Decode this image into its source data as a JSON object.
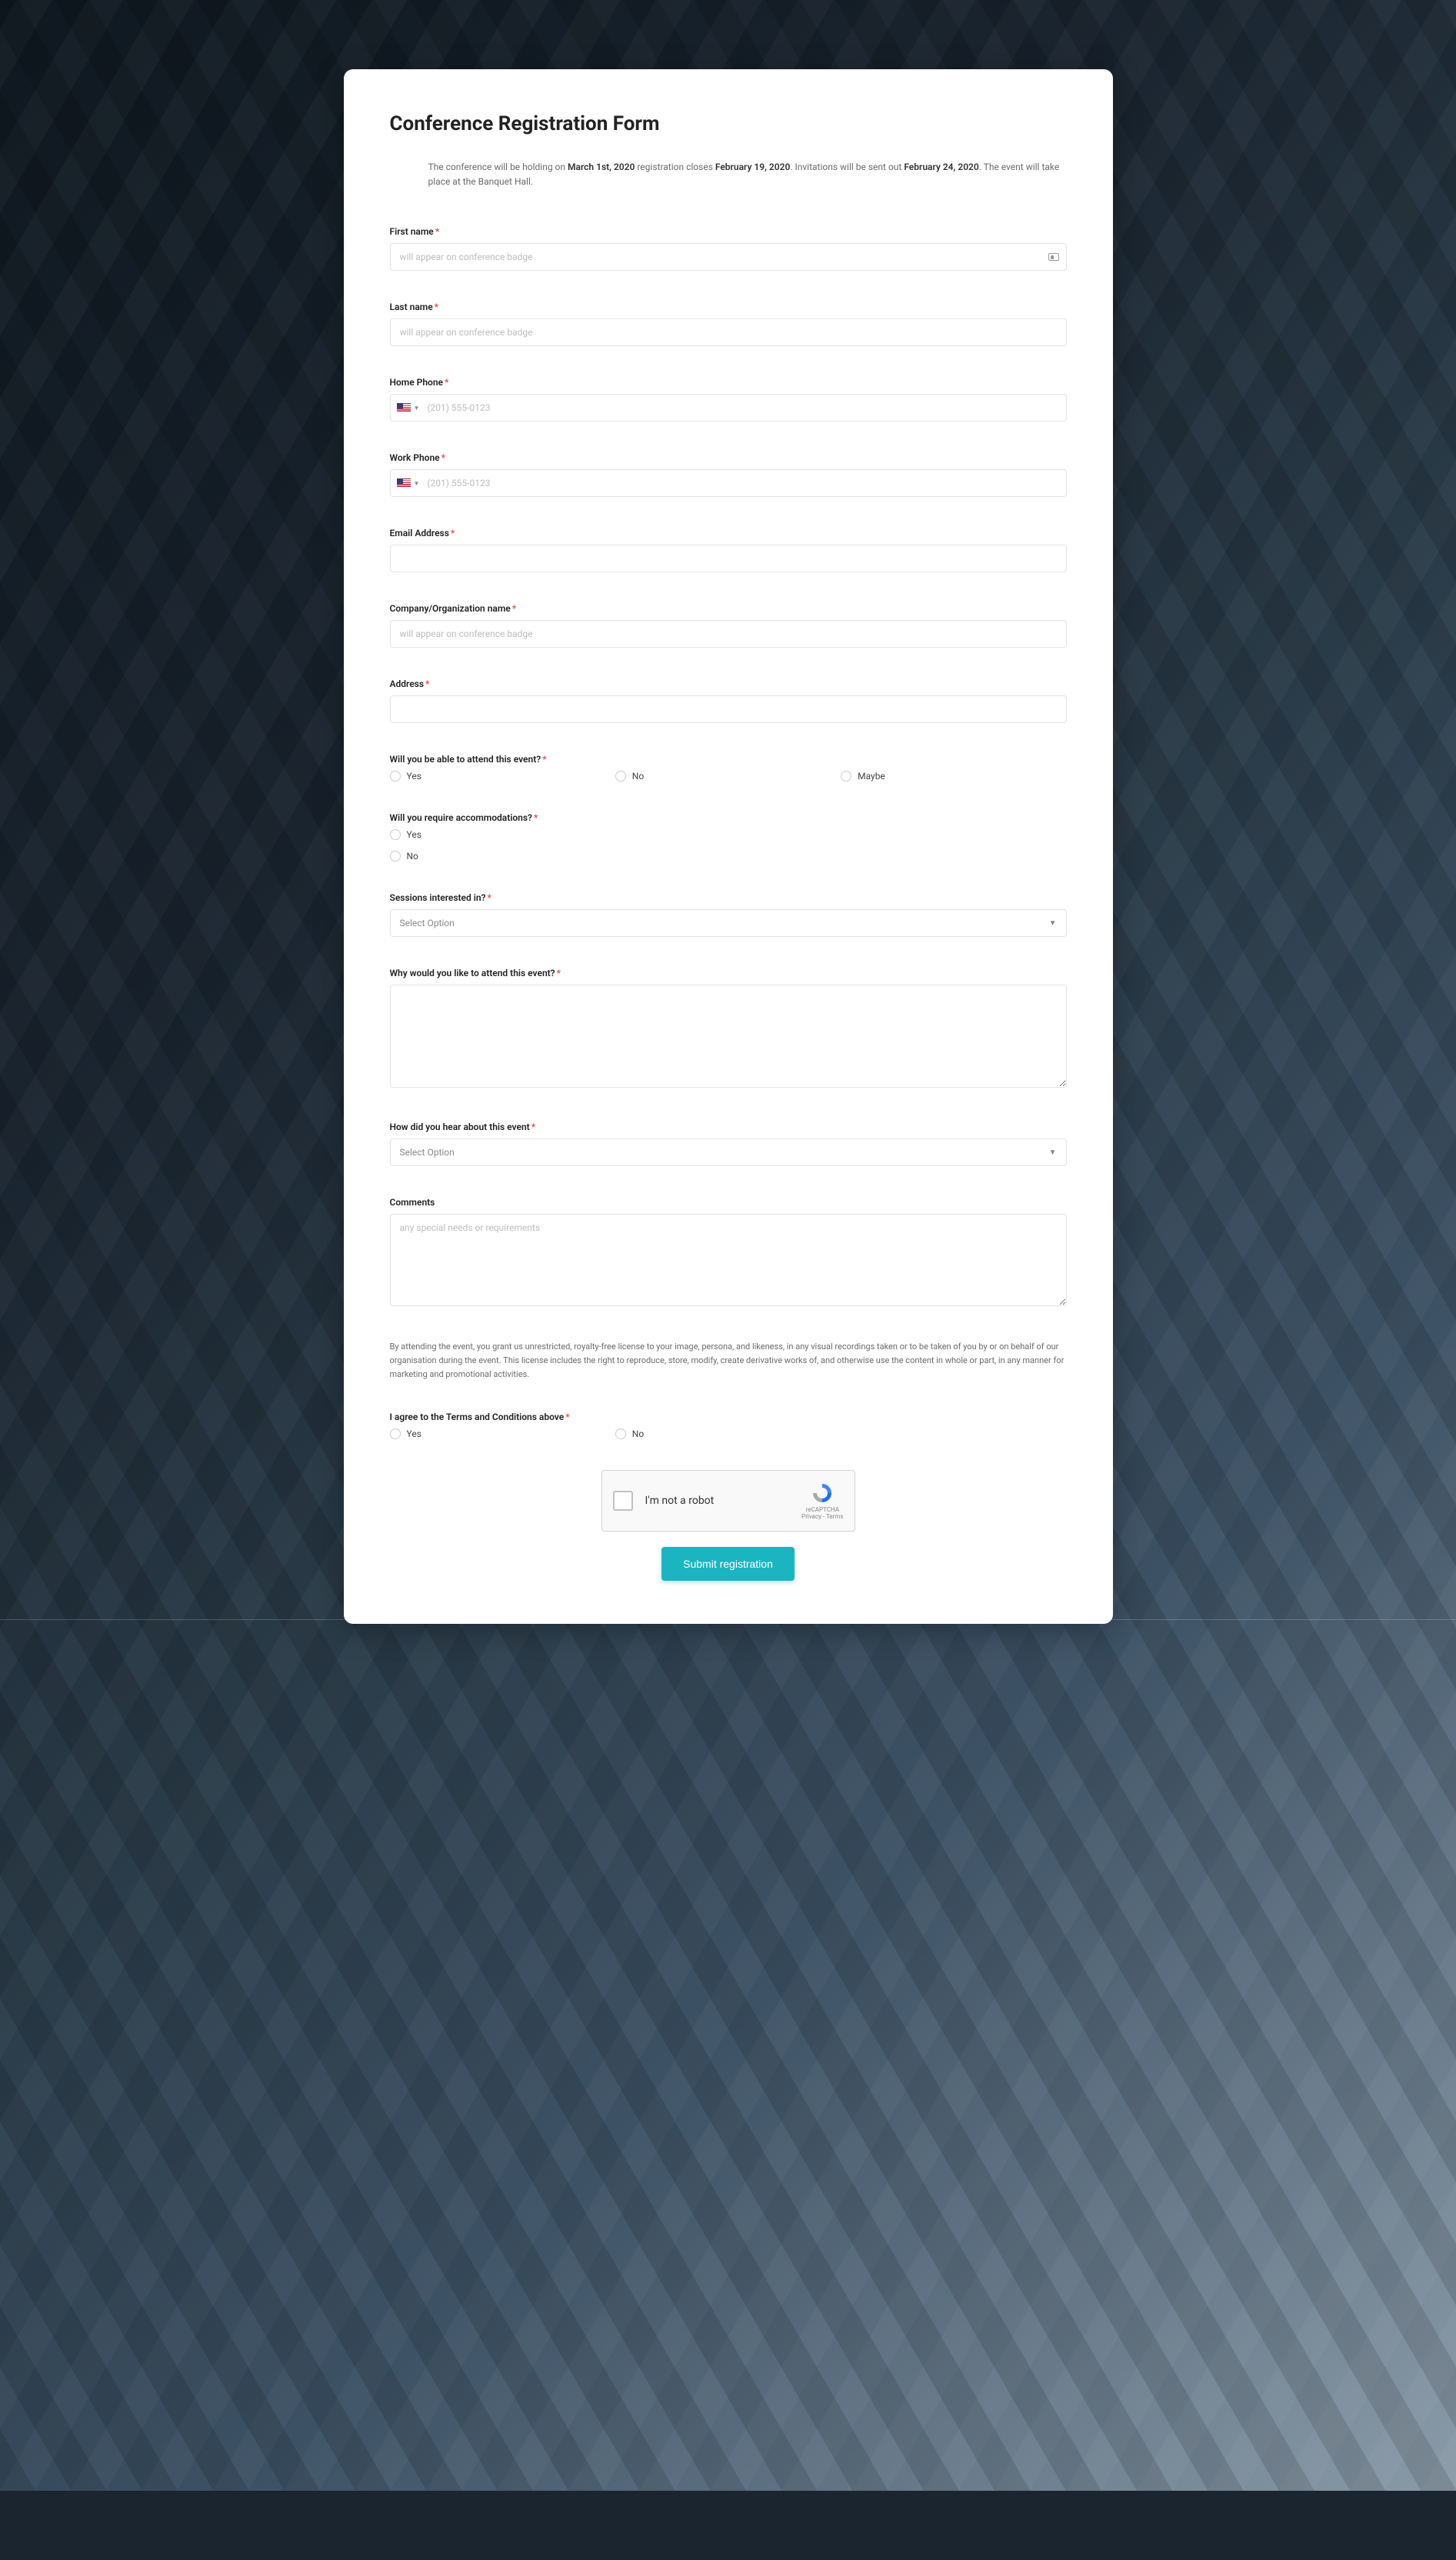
{
  "title": "Conference Registration Form",
  "intro": {
    "part1": "The conference will be holding on ",
    "date1": "March 1st, 2020",
    "part2": " registration closes ",
    "date2": "February 19, 2020",
    "part3": ". Invitations will be sent out ",
    "date3": "February 24, 2020",
    "part4": ". The event will take place at the Banquet Hall."
  },
  "fields": {
    "first_name": {
      "label": "First name",
      "placeholder": "will appear on conference badge"
    },
    "last_name": {
      "label": "Last name",
      "placeholder": "will appear on conference badge"
    },
    "home_phone": {
      "label": "Home Phone",
      "placeholder": "(201) 555-0123"
    },
    "work_phone": {
      "label": "Work Phone",
      "placeholder": "(201) 555-0123"
    },
    "email": {
      "label": "Email Address"
    },
    "company": {
      "label": "Company/Organization name",
      "placeholder": "will appear on conference badge"
    },
    "address": {
      "label": "Address"
    },
    "attend": {
      "label": "Will you be able to attend this event?",
      "options": [
        "Yes",
        "No",
        "Maybe"
      ]
    },
    "accommodations": {
      "label": "Will you require accommodations?",
      "options": [
        "Yes",
        "No"
      ]
    },
    "sessions": {
      "label": "Sessions interested in?",
      "placeholder": "Select Option"
    },
    "why": {
      "label": "Why would you like to attend this event?"
    },
    "hear": {
      "label": "How did you hear about this event",
      "placeholder": "Select Option"
    },
    "comments": {
      "label": "Comments",
      "placeholder": "any special needs or requirements"
    },
    "agree": {
      "label": "I agree to the Terms and Conditions above",
      "options": [
        "Yes",
        "No"
      ]
    }
  },
  "terms_text": "By attending the event, you grant us unrestricted, royalty-free license to your image, persona, and likeness, in any visual recordings taken or to be taken of you by or on behalf of our organisation during the event. This license includes the right to reproduce, store, modify, create derivative works of, and otherwise use the content in whole or part, in any manner for marketing and promotional activities.",
  "recaptcha": {
    "label": "I'm not a robot",
    "brand": "reCAPTCHA",
    "sub": "Privacy - Terms"
  },
  "submit_label": "Submit registration"
}
